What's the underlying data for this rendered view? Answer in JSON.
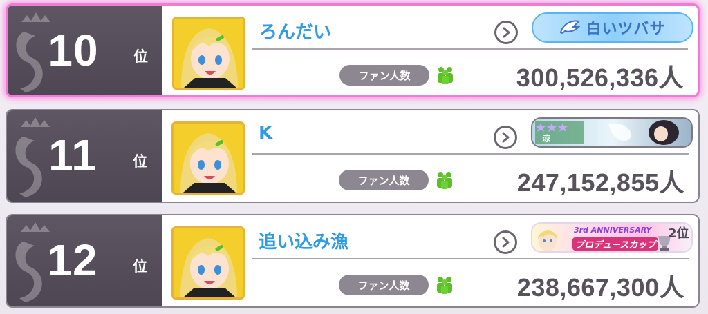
{
  "rankings": [
    {
      "rank": "10",
      "rank_suffix": "位",
      "name": "ろんだい",
      "fan_label": "ファン人数",
      "fan_count": "300,526,336人",
      "badge": {
        "type": "title",
        "text": "白いツバサ",
        "icon": "wing-icon"
      },
      "highlight": true
    },
    {
      "rank": "11",
      "rank_suffix": "位",
      "name": "K",
      "fan_label": "ファン人数",
      "fan_count": "247,152,855人",
      "badge": {
        "type": "card",
        "char_label": "涼",
        "icon": "star-rating-icon"
      }
    },
    {
      "rank": "12",
      "rank_suffix": "位",
      "name": "追い込み漁",
      "fan_label": "ファン人数",
      "fan_count": "238,667,300人",
      "badge": {
        "type": "event",
        "line1": "3rd ANNIVERSARY",
        "line2": "プロデュースカップ",
        "place": "2位"
      }
    }
  ],
  "colors": {
    "name": "#2f9be6",
    "rank_block": "#534c58",
    "highlight_border": "#f07bd2",
    "fan_icon": "#5cbf2a",
    "badge_blue": "#3a73c7"
  }
}
